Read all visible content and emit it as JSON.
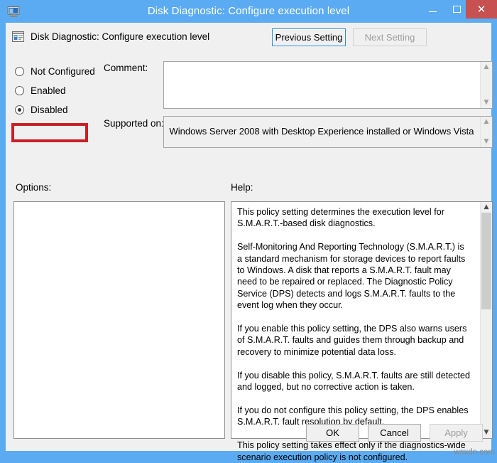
{
  "window": {
    "title": "Disk Diagnostic: Configure execution level",
    "title_icon": "monitor-icon",
    "minimize_glyph": "minimize-icon",
    "maximize_glyph": "maximize-icon",
    "close_glyph": "✕",
    "titlebar_color": "#5babf2",
    "close_button_color": "#c75050"
  },
  "header": {
    "policy_icon": "policy-setting-icon",
    "policy_title": "Disk Diagnostic: Configure execution level",
    "previous_setting_label": "Previous Setting",
    "next_setting_label": "Next Setting"
  },
  "state": {
    "options": [
      {
        "label": "Not Configured",
        "selected": false
      },
      {
        "label": "Enabled",
        "selected": false
      },
      {
        "label": "Disabled",
        "selected": true
      }
    ],
    "highlight_color": "#cc2026"
  },
  "fields": {
    "comment_label": "Comment:",
    "comment_value": "",
    "supported_on_label": "Supported on:",
    "supported_on_value": "Windows Server 2008 with Desktop Experience installed or Windows Vista"
  },
  "panels": {
    "options_label": "Options:",
    "options_content": "",
    "help_label": "Help:",
    "help_text": "This policy setting determines the execution level for S.M.A.R.T.-based disk diagnostics.\n\nSelf-Monitoring And Reporting Technology (S.M.A.R.T.) is a standard mechanism for storage devices to report faults to Windows. A disk that reports a S.M.A.R.T. fault may need to be repaired or replaced. The Diagnostic Policy Service (DPS) detects and logs S.M.A.R.T. faults to the event log when they occur.\n\nIf you enable this policy setting, the DPS also warns users of S.M.A.R.T. faults and guides them through backup and recovery to minimize potential data loss.\n\nIf you disable this policy, S.M.A.R.T. faults are still detected and logged, but no corrective action is taken.\n\nIf you do not configure this policy setting, the DPS enables S.M.A.R.T. fault resolution by default.\n\nThis policy setting takes effect only if the diagnostics-wide scenario execution policy is not configured."
  },
  "footer": {
    "ok_label": "OK",
    "cancel_label": "Cancel",
    "apply_label": "Apply"
  },
  "watermark": "wsxdn.com"
}
